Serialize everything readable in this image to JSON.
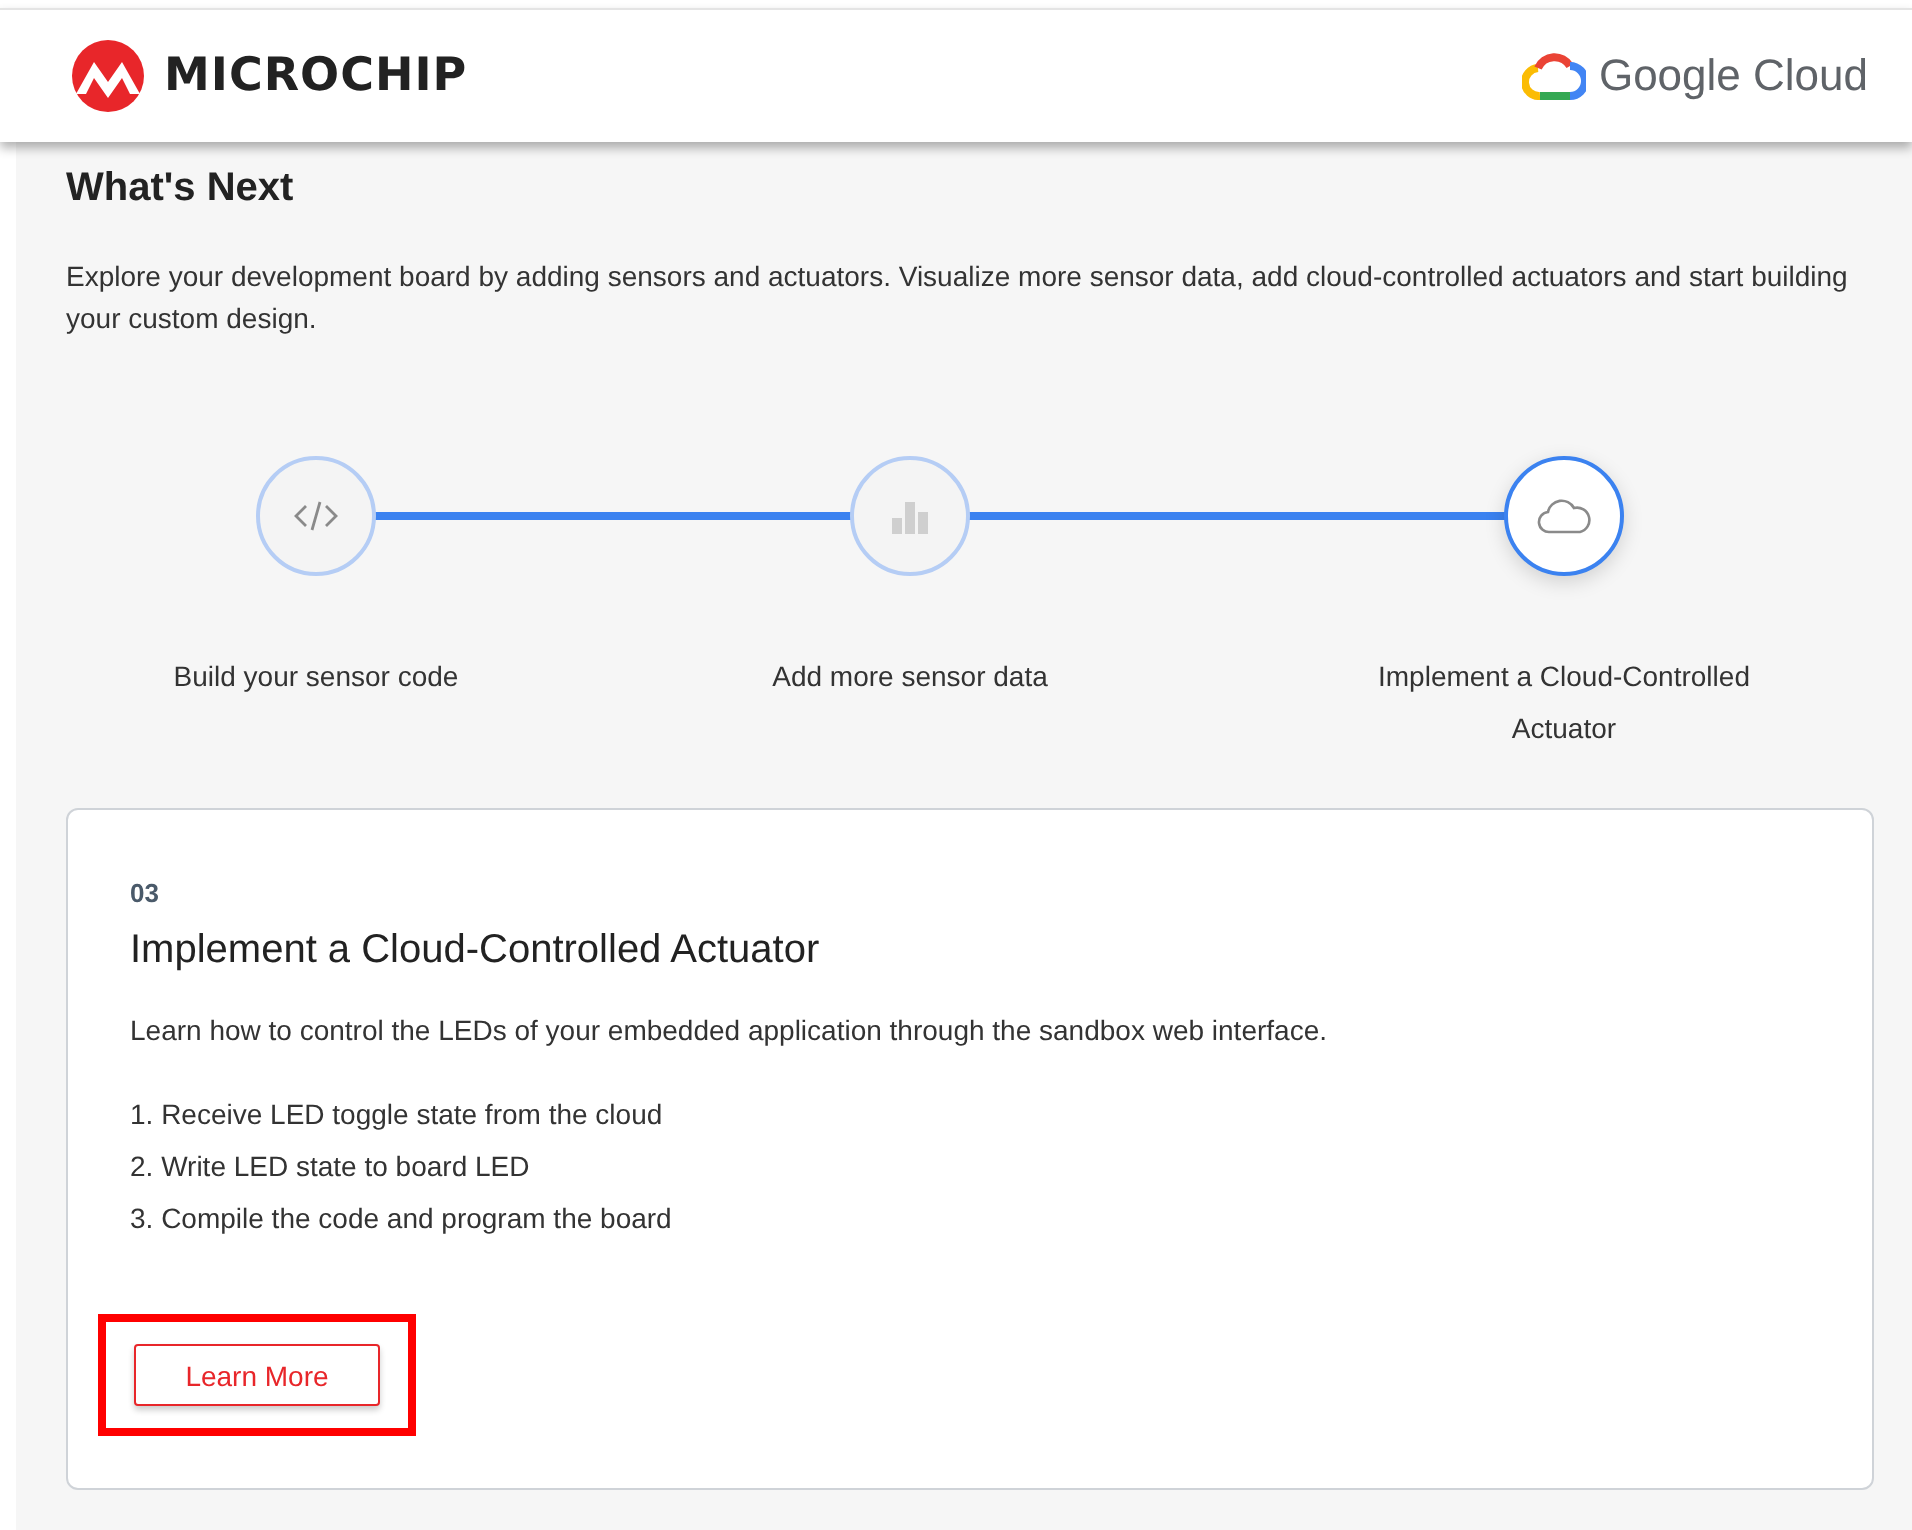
{
  "header": {
    "brand": "MICROCHIP",
    "partner": "Google Cloud"
  },
  "section": {
    "title": "What's Next",
    "intro": "Explore your development board by adding sensors and actuators. Visualize more sensor data, add cloud-controlled actuators and start building your custom design."
  },
  "steps": [
    {
      "label": "Build your sensor code",
      "kind": "code",
      "selected": false
    },
    {
      "label": "Add more sensor data",
      "kind": "chart",
      "selected": false
    },
    {
      "label": "Implement a Cloud-Controlled Actuator",
      "kind": "cloud",
      "selected": true
    }
  ],
  "card": {
    "number": "03",
    "title": "Implement a Cloud-Controlled Actuator",
    "description": "Learn how to control the LEDs of your embedded application through the sandbox web interface.",
    "items": [
      "1. Receive LED toggle state from the cloud",
      "2. Write LED state to board LED",
      "3. Compile the code and program the board"
    ],
    "button": {
      "label": "Learn More",
      "highlighted": true
    }
  }
}
